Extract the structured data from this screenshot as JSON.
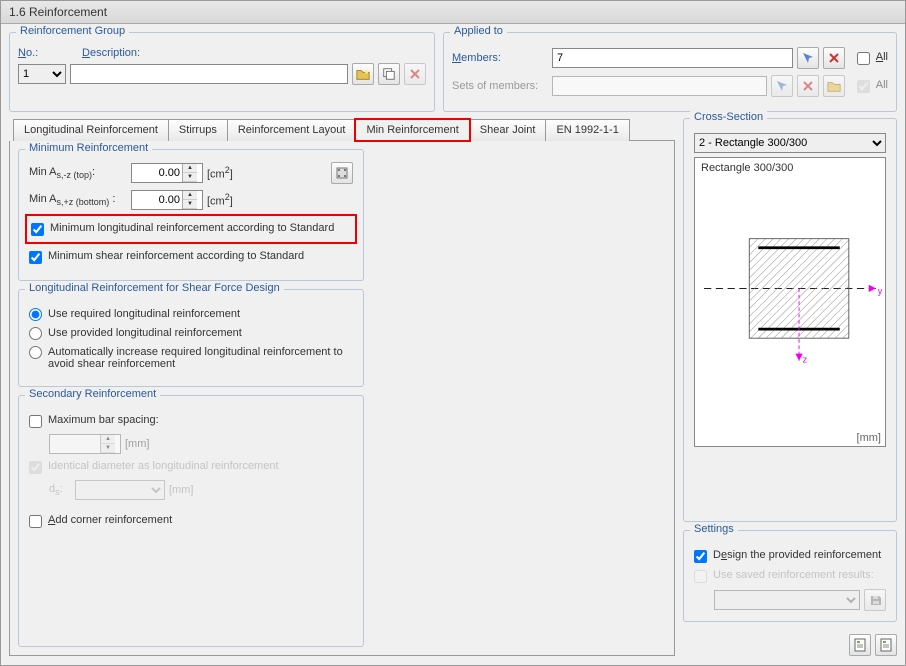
{
  "window": {
    "title": "1.6 Reinforcement"
  },
  "groups": {
    "reinforcement": {
      "title": "Reinforcement Group",
      "no_label_rest": "o.:",
      "desc_label_rest": "escription:",
      "no_value": "1",
      "desc_value": ""
    },
    "applied": {
      "title": "Applied to",
      "members_label_rest": "embers:",
      "members_value": "7",
      "sets_label": "Sets of members:",
      "all_label_rest": "ll",
      "all_label2": "All"
    }
  },
  "tabs": [
    "Longitudinal Reinforcement",
    "Stirrups",
    "Reinforcement Layout",
    "Min Reinforcement",
    "Shear Joint",
    "EN 1992-1-1"
  ],
  "panels": {
    "min": {
      "title": "Minimum Reinforcement",
      "top_value": "0.00",
      "bot_value": "0.00",
      "chk_long": "Minimum longitudinal reinforcement according to Standard",
      "chk_shear": "Minimum shear reinforcement according to Standard"
    },
    "long_shear": {
      "title": "Longitudinal Reinforcement for Shear Force Design",
      "opt1": "Use required longitudinal reinforcement",
      "opt2": "Use provided longitudinal reinforcement",
      "opt3": "Automatically increase required longitudinal reinforcement to avoid shear reinforcement"
    },
    "secondary": {
      "title": "Secondary Reinforcement",
      "chk_spacing": "Maximum bar spacing:",
      "unit_mm": "[mm]",
      "chk_identical": "Identical diameter as longitudinal reinforcement",
      "chk_corner_rest": "dd corner reinforcement"
    }
  },
  "cross_section": {
    "title": "Cross-Section",
    "selected": "2 - Rectangle 300/300",
    "shape_label": "Rectangle 300/300",
    "unit": "[mm]"
  },
  "settings": {
    "title": "Settings",
    "chk_design_rest": "sign the provided reinforcement",
    "chk_saved": "Use saved reinforcement results:"
  }
}
